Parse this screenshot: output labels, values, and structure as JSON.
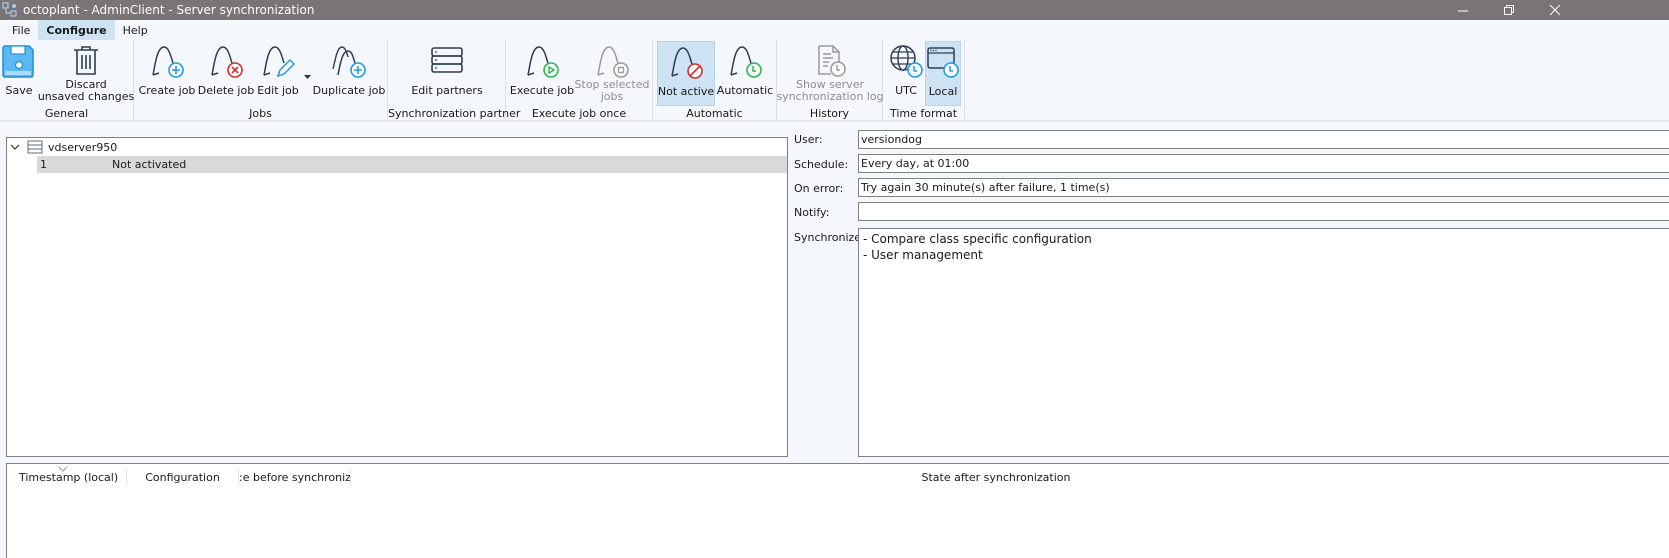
{
  "window": {
    "title": "octoplant - AdminClient - Server synchronization",
    "controls": [
      "minimize",
      "restore",
      "close"
    ]
  },
  "menu": {
    "items": [
      {
        "label": "File",
        "active": false
      },
      {
        "label": "Configure",
        "active": true
      },
      {
        "label": "Help",
        "active": false
      }
    ]
  },
  "ribbon": {
    "groups": {
      "general": {
        "label": "General",
        "save": "Save",
        "discard_line1": "Discard",
        "discard_line2": "unsaved changes"
      },
      "jobs": {
        "label": "Jobs",
        "create": "Create job",
        "delete": "Delete job",
        "edit": "Edit job",
        "duplicate": "Duplicate job"
      },
      "partner": {
        "label": "Synchronization partner",
        "edit_partners": "Edit partners"
      },
      "execute": {
        "label": "Execute job once",
        "execute": "Execute job",
        "stop_line1": "Stop selected",
        "stop_line2": "jobs"
      },
      "automatic": {
        "label": "Automatic",
        "not_active": "Not active",
        "automatic": "Automatic",
        "selected": "Not active"
      },
      "history": {
        "label": "History",
        "log_line1": "Show server",
        "log_line2": "synchronization log"
      },
      "time_format": {
        "label": "Time format",
        "utc": "UTC",
        "local": "Local",
        "selected": "Local"
      }
    },
    "colors": {
      "accent_blue": "#1e9be9",
      "delete_red": "#d32f2f",
      "execute_green": "#2db84b",
      "selected_bg": "#cde3f3",
      "icon_dark": "#2d3e55"
    }
  },
  "tree": {
    "server": "vdserver950",
    "jobs": [
      {
        "id": "1",
        "status": "Not activated"
      }
    ]
  },
  "details": {
    "user_label": "User:",
    "user_value": "versiondog",
    "schedule_label": "Schedule:",
    "schedule_value": "Every day, at 01:00",
    "on_error_label": "On error:",
    "on_error_value": "Try again 30 minute(s) after failure, 1 time(s)",
    "notify_label": "Notify:",
    "notify_value": "",
    "synchronize_label": "Synchronize:",
    "synchronize_items": [
      "- Compare class specific configuration",
      "- User management"
    ]
  },
  "log_table": {
    "columns": [
      "Timestamp (local)",
      "Configuration",
      "State before synchronization",
      "State after synchronization"
    ],
    "column3_visible_text": ":e before synchronizat"
  }
}
